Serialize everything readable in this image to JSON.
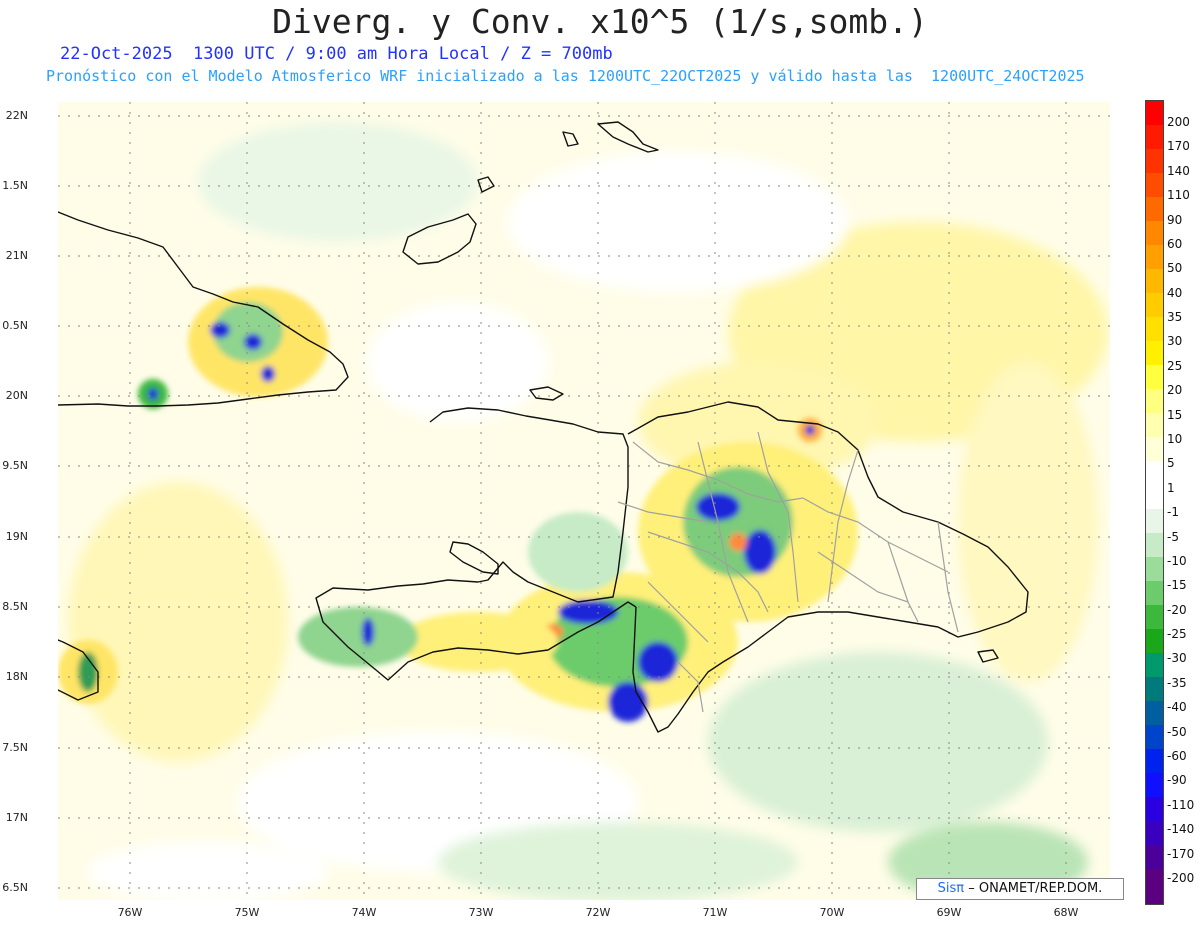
{
  "header": {
    "title": "Diverg. y Conv. x10^5 (1/s,somb.)",
    "line1": "22-Oct-2025  1300 UTC / 9:00 am Hora Local / Z = 700mb",
    "line2": "Pronóstico con el Modelo Atmosferico WRF inicializado a las 1200UTC_22OCT2025 y válido hasta las  1200UTC_24OCT2025"
  },
  "axes": {
    "lat_labels": [
      "22N",
      "1.5N",
      "21N",
      "0.5N",
      "20N",
      "9.5N",
      "19N",
      "8.5N",
      "18N",
      "7.5N",
      "17N",
      "6.5N"
    ],
    "lon_labels": [
      "76W",
      "75W",
      "74W",
      "73W",
      "72W",
      "71W",
      "70W",
      "69W",
      "68W"
    ]
  },
  "colorbar": {
    "labels": [
      "200",
      "170",
      "140",
      "110",
      "90",
      "60",
      "50",
      "40",
      "35",
      "30",
      "25",
      "20",
      "15",
      "10",
      "5",
      "1",
      "-1",
      "-5",
      "-10",
      "-15",
      "-20",
      "-25",
      "-30",
      "-35",
      "-40",
      "-50",
      "-60",
      "-90",
      "-110",
      "-140",
      "-170",
      "-200"
    ],
    "colors": [
      "#ff0000",
      "#ff1a00",
      "#ff3300",
      "#ff4d00",
      "#ff6a00",
      "#ff8800",
      "#ffa000",
      "#ffb800",
      "#ffcc00",
      "#ffe000",
      "#fff000",
      "#ffff40",
      "#ffff80",
      "#ffffb0",
      "#ffffd8",
      "#ffffff",
      "#ffffff",
      "#e8f5e8",
      "#c6ebc6",
      "#9adc9a",
      "#6ccc6c",
      "#3cb83c",
      "#1aa81a",
      "#00996b",
      "#007a7a",
      "#005fa0",
      "#0044cc",
      "#0022ee",
      "#1010ff",
      "#2a00e0",
      "#3a00c0",
      "#4a0099",
      "#5a0080"
    ]
  },
  "credit": {
    "sis": "Sisπ",
    "org": "– ONAMET/REP.DOM."
  }
}
